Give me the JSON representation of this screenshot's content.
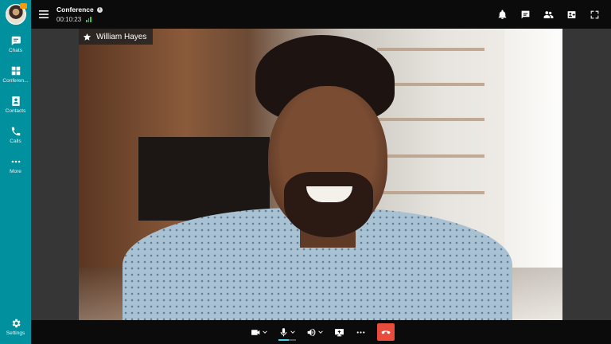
{
  "sidebar": {
    "items": [
      {
        "label": "Chats",
        "icon": "chat-icon"
      },
      {
        "label": "Conferen...",
        "icon": "conference-icon"
      },
      {
        "label": "Contacts",
        "icon": "contacts-icon"
      },
      {
        "label": "Calls",
        "icon": "calls-icon"
      },
      {
        "label": "More",
        "icon": "more-dots-icon"
      }
    ],
    "settings_label": "Settings"
  },
  "header": {
    "title": "Conference",
    "timer": "00:10:23"
  },
  "participant": {
    "name": "William Hayes"
  },
  "colors": {
    "sidebar": "#00909e",
    "hangup": "#e74c3c",
    "signal": "#2ecc40"
  },
  "mic_level": 0.6
}
